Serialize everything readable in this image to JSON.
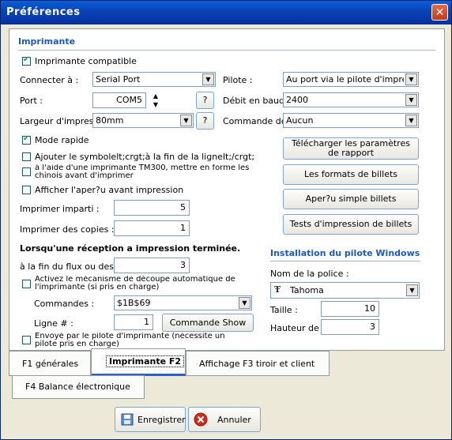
{
  "window": {
    "title": "Préférences",
    "close_glyph": "✕"
  },
  "printer": {
    "section_title": "Imprimante",
    "compatible_label": "Imprimante compatible",
    "connect_label": "Connecter à :",
    "connect_value": "Serial Port",
    "port_label": "Port :",
    "port_value": "COM5",
    "help_label": "?",
    "width_label": "Largeur d'impressio",
    "width_value": "80mm",
    "driver_label": "Pilote :",
    "driver_value": "Au port via le pilote d'impression",
    "baud_label": "Débit en bauds",
    "baud_value": "2400",
    "command_label": "Commande de p",
    "command_value": "Aucun",
    "fast_mode_label": "Mode rapide",
    "add_symbol_label": "Ajouter le symbolelt;crgt;à la fin de la lignelt;/crgt;",
    "tm300_label": "à l'aide d'une imprimante TM300, mettre en forme les chinois avant d'imprimer",
    "preview_label": "Afficher l'aper?u avant impression",
    "print_imparti_label": "Imprimer imparti :",
    "print_imparti_value": "5",
    "print_copies_label": "Imprimer des copies :",
    "print_copies_value": "1"
  },
  "right_buttons": {
    "download_label": "Télécharger les paramètres de rapport",
    "formats_label": "Les formats de billets",
    "preview_label": "Aper?u simple billets",
    "tests_label": "Tests d'impression de billets"
  },
  "reception": {
    "title": "Lorsqu'une réception a impression terminée.",
    "end_flow_label": "à la fin du flux ou des lign",
    "end_flow_value": "3",
    "auto_cut_label": "Activez le mécanisme de découpe automatique de l'imprimante (si pris en charge)",
    "commands_label": "Commandes :",
    "commands_value": "$1B$69",
    "line_label": "Ligne # :",
    "line_value": "1",
    "command_show_label": "Commande Show",
    "send_driver_label": "Envoyé par le pilote d'imprimante (nécessite un pilote pris en charge)"
  },
  "driver_install": {
    "title": "Installation du pilote Windows",
    "font_name_label": "Nom de la police :",
    "font_name_value": "Tahoma",
    "size_label": "Taille :",
    "size_value": "10",
    "line_height_label": "Hauteur de lig",
    "line_height_value": "3"
  },
  "tabs": [
    {
      "label": "F1 générales"
    },
    {
      "label": "Imprimante F2"
    },
    {
      "label": "Affichage F3 tiroir et client"
    },
    {
      "label": "F4 Balance électronique"
    }
  ],
  "footer": {
    "save_label": "Enregistrer",
    "cancel_label": "Annuler"
  },
  "colors": {
    "title_bar": "#0a44b8",
    "section_title": "#1c5ab4",
    "cancel_icon": "#d42a1c"
  },
  "icons": [
    "close-icon",
    "checkbox-checked",
    "dropdown-arrow-icon",
    "spin-up-icon",
    "spin-down-icon",
    "font-tt-icon",
    "tab-arrow-icon",
    "save-icon",
    "cancel-icon"
  ]
}
